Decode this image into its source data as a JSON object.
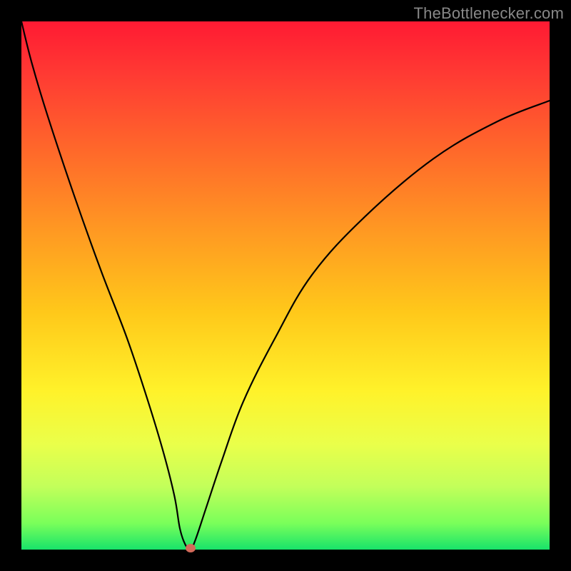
{
  "watermark": {
    "text": "TheBottlenecker.com"
  },
  "chart_data": {
    "type": "line",
    "x": [
      0,
      2,
      5,
      10,
      15,
      20,
      24,
      27,
      29,
      30,
      31,
      32,
      33,
      35,
      38,
      42,
      48,
      55,
      65,
      78,
      90,
      100
    ],
    "values": [
      100,
      92,
      82,
      67,
      53,
      40,
      28,
      18,
      10,
      4,
      1,
      0,
      2,
      8,
      17,
      28,
      40,
      52,
      63,
      74,
      81,
      85
    ],
    "title": "",
    "xlabel": "",
    "ylabel": "",
    "xlim": [
      0,
      100
    ],
    "ylim": [
      0,
      100
    ],
    "annotations": [
      {
        "type": "marker",
        "x": 32,
        "y": 0,
        "color": "#d36a5a"
      }
    ],
    "gradient": {
      "stops": [
        {
          "pos": 0,
          "color": "#ff1a33"
        },
        {
          "pos": 10,
          "color": "#ff3a33"
        },
        {
          "pos": 25,
          "color": "#ff6a2a"
        },
        {
          "pos": 40,
          "color": "#ff9a22"
        },
        {
          "pos": 55,
          "color": "#ffc81a"
        },
        {
          "pos": 70,
          "color": "#fff22a"
        },
        {
          "pos": 80,
          "color": "#eaff4a"
        },
        {
          "pos": 88,
          "color": "#c3ff5a"
        },
        {
          "pos": 95,
          "color": "#7aff5a"
        },
        {
          "pos": 100,
          "color": "#18e36a"
        }
      ]
    }
  },
  "colors": {
    "frame": "#000000",
    "curve": "#000000",
    "watermark": "#888888",
    "marker": "#d36a5a"
  }
}
